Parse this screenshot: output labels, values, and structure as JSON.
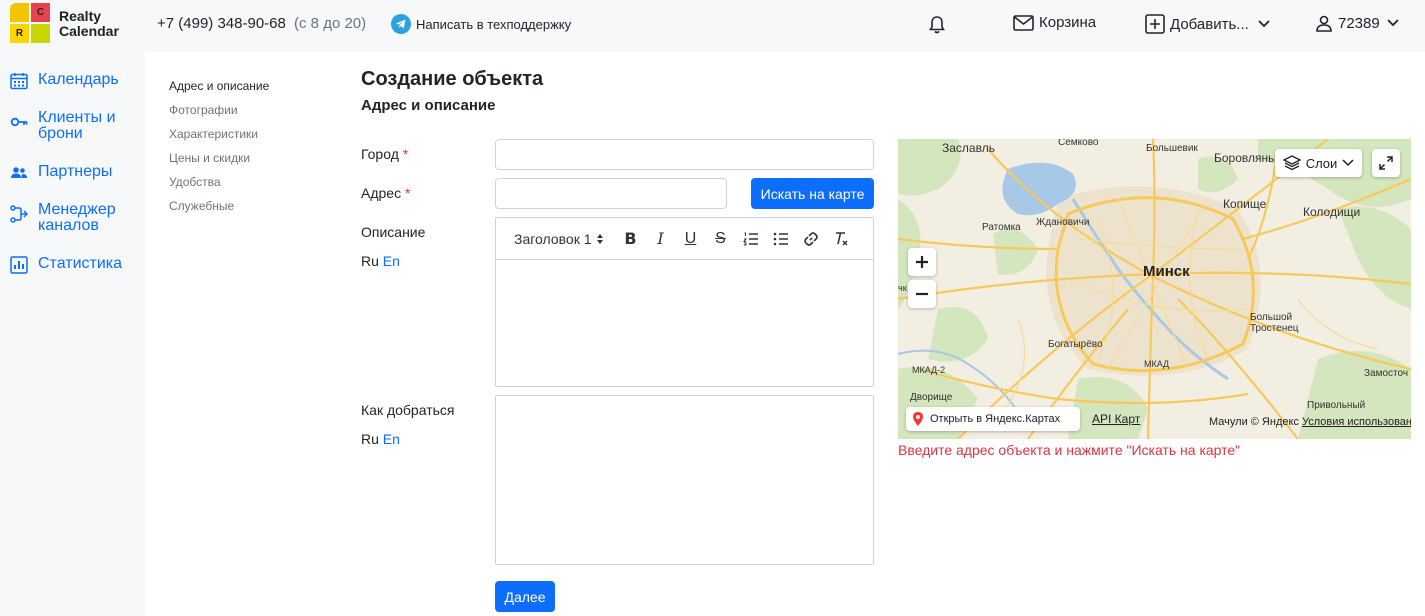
{
  "header": {
    "logo_letters": [
      "",
      "C",
      "R",
      ""
    ],
    "logo_text_1": "Realty",
    "logo_text_2": "Calendar",
    "phone": "+7 (499) 348-90-68",
    "hours": "(с 8 до 20)",
    "support_link": "Написать в техподдержку",
    "cart_label": "Корзина",
    "add_label": "Добавить...",
    "user_id": "72389"
  },
  "sidebar": {
    "items": [
      {
        "label": "Календарь",
        "icon": "calendar-icon"
      },
      {
        "label": "Клиенты и брони",
        "icon": "key-icon"
      },
      {
        "label": "Партнеры",
        "icon": "users-icon"
      },
      {
        "label": "Менеджер каналов",
        "icon": "channels-icon"
      },
      {
        "label": "Статистика",
        "icon": "chart-icon"
      }
    ]
  },
  "subnav": {
    "items": [
      "Адрес и описание",
      "Фотографии",
      "Характеристики",
      "Цены и скидки",
      "Удобства",
      "Служебные"
    ]
  },
  "form": {
    "title": "Создание объекта",
    "section": "Адрес и описание",
    "city_label": "Город",
    "address_label": "Адрес",
    "required_mark": "*",
    "search_map_button": "Искать на карте",
    "description_label": "Описание",
    "directions_label": "Как добраться",
    "lang_ru": "Ru",
    "lang_en": "En",
    "heading_select": "Заголовок 1",
    "next_button": "Далее",
    "hint": "Введите адрес объекта и нажмите \"Искать на карте\""
  },
  "map": {
    "places": [
      "Заславль",
      "Семково",
      "Большевик",
      "Боровляны",
      "Копище",
      "Колодищи",
      "Ратомка",
      "Ждановичи",
      "Минск",
      "Большой Тростенец",
      "Богатырёво",
      "Дворище",
      "Привольный",
      "Замосточ",
      "МКАД",
      "МКАД-2",
      "чк"
    ],
    "layers_button": "Слои",
    "open_in_yandex": "Открыть в Яндекс.Картах",
    "api_link": "API Карт",
    "copyright": "Мачули © Яндекс",
    "terms_link": "Условия использования"
  }
}
